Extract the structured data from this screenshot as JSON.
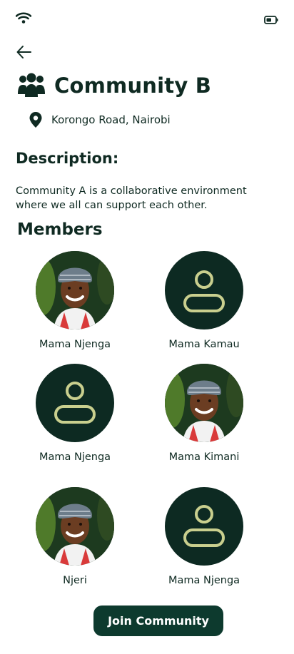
{
  "community": {
    "title": "Community B",
    "location": "Korongo Road, Nairobi"
  },
  "description": {
    "heading": "Description:",
    "text": "Community A is a collaborative environment where we all can support each other."
  },
  "members": {
    "heading": "Members",
    "list": [
      {
        "name": "Mama Njenga",
        "avatar": "photo"
      },
      {
        "name": "Mama Kamau",
        "avatar": "placeholder-user-icon"
      },
      {
        "name": "Mama Njenga",
        "avatar": "placeholder-user-icon"
      },
      {
        "name": "Mama Kimani",
        "avatar": "photo"
      },
      {
        "name": "Njeri",
        "avatar": "photo"
      },
      {
        "name": "Mama Njenga",
        "avatar": "placeholder-user-icon"
      }
    ]
  },
  "actions": {
    "join_label": "Join Community"
  },
  "colors": {
    "primary": "#0d3a2e",
    "text": "#0f2a22",
    "avatar_bg": "#0d2a22",
    "avatar_icon": "#c9cf8e"
  },
  "icons": {
    "status_left": "wifi-icon",
    "status_right": "battery-icon",
    "back": "arrow-left-icon",
    "title": "people-group-icon",
    "location": "map-pin-icon"
  }
}
